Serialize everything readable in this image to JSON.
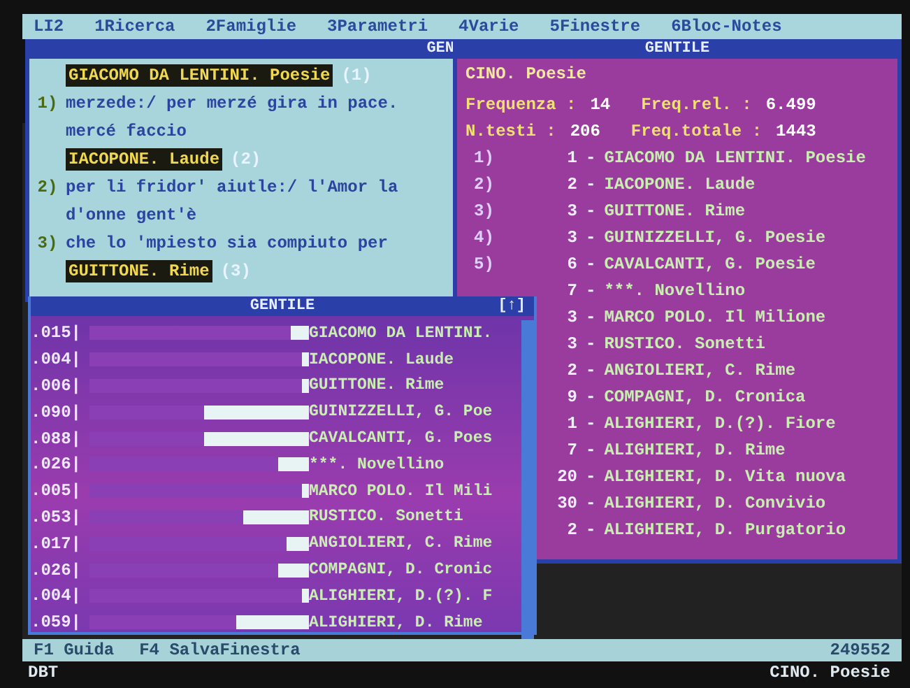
{
  "menu": [
    {
      "label": "LI2"
    },
    {
      "label": "1Ricerca"
    },
    {
      "label": "2Famiglie"
    },
    {
      "label": "3Parametri"
    },
    {
      "label": "4Varie"
    },
    {
      "label": "5Finestre"
    },
    {
      "label": "6Bloc-Notes"
    }
  ],
  "text_window": {
    "title": "GEN",
    "entries": [
      {
        "kind": "heading",
        "text": "GIACOMO DA LENTINI. Poesie",
        "ref": "(1)"
      },
      {
        "kind": "line",
        "number": "1)",
        "text": "merzede:/ per merzé gira in pace."
      },
      {
        "kind": "line",
        "text": "mercé faccio"
      },
      {
        "kind": "heading",
        "text": "IACOPONE. Laude",
        "ref": "(2)"
      },
      {
        "kind": "line",
        "number": "2)",
        "text": "per li fridor' aiutle:/ l'Amor la"
      },
      {
        "kind": "line",
        "text": "d'onne gent'è"
      },
      {
        "kind": "line",
        "number": "3)",
        "text": "che lo 'mpiesto sia compiuto per"
      },
      {
        "kind": "heading",
        "text": "GUITTONE. Rime",
        "ref": "(3)"
      }
    ]
  },
  "stats_window": {
    "title": "GENTILE",
    "heading": "CINO. Poesie",
    "stats": [
      [
        {
          "label": "Frequenza :",
          "value": "14"
        },
        {
          "label": "Freq.rel. :",
          "value": "6.499"
        }
      ],
      [
        {
          "label": "N.testi :",
          "value": "206"
        },
        {
          "label": "Freq.totale :",
          "value": "1443"
        }
      ]
    ],
    "rows": [
      {
        "index": "1)",
        "count": "1",
        "dash": "-",
        "name": "GIACOMO DA LENTINI. Poesie"
      },
      {
        "index": "2)",
        "count": "2",
        "dash": "-",
        "name": "IACOPONE. Laude"
      },
      {
        "index": "3)",
        "count": "3",
        "dash": "-",
        "name": "GUITTONE. Rime"
      },
      {
        "index": "4)",
        "count": "3",
        "dash": "-",
        "name": "GUINIZZELLI, G. Poesie"
      },
      {
        "index": "5)",
        "count": "6",
        "dash": "-",
        "name": "CAVALCANTI, G. Poesie"
      },
      {
        "count": "7",
        "dash": "-",
        "name": "***. Novellino"
      },
      {
        "count": "3",
        "dash": "-",
        "name": "MARCO POLO. Il Milione"
      },
      {
        "count": "3",
        "dash": "-",
        "name": "RUSTICO. Sonetti"
      },
      {
        "count": "2",
        "dash": "-",
        "name": "ANGIOLIERI, C. Rime"
      },
      {
        "count": "9",
        "dash": "-",
        "name": "COMPAGNI, D. Cronica"
      },
      {
        "count": "1",
        "dash": "-",
        "name": "ALIGHIERI, D.(?). Fiore"
      },
      {
        "count": "7",
        "dash": "-",
        "name": "ALIGHIERI, D. Rime"
      },
      {
        "count": "20",
        "dash": "-",
        "name": "ALIGHIERI, D. Vita nuova"
      },
      {
        "count": "30",
        "dash": "-",
        "name": "ALIGHIERI, D. Convivio"
      },
      {
        "count": "2",
        "dash": "-",
        "name": "ALIGHIERI, D. Purgatorio"
      }
    ]
  },
  "bar_window": {
    "title": "GENTILE",
    "corner": "[↑]",
    "rows": [
      {
        "value": ".015|",
        "level": 0.08,
        "name": "GIACOMO DA LENTINI."
      },
      {
        "value": ".004|",
        "level": 0.03,
        "name": "IACOPONE. Laude"
      },
      {
        "value": ".006|",
        "level": 0.03,
        "name": "GUITTONE. Rime"
      },
      {
        "value": ".090|",
        "level": 0.48,
        "name": "GUINIZZELLI, G. Poe"
      },
      {
        "value": ".088|",
        "level": 0.48,
        "name": "CAVALCANTI, G. Poes"
      },
      {
        "value": ".026|",
        "level": 0.14,
        "name": "***. Novellino"
      },
      {
        "value": ".005|",
        "level": 0.03,
        "name": "MARCO POLO. Il Mili"
      },
      {
        "value": ".053|",
        "level": 0.3,
        "name": "RUSTICO. Sonetti"
      },
      {
        "value": ".017|",
        "level": 0.1,
        "name": "ANGIOLIERI, C. Rime"
      },
      {
        "value": ".026|",
        "level": 0.14,
        "name": "COMPAGNI, D. Cronic"
      },
      {
        "value": ".004|",
        "level": 0.03,
        "name": "ALIGHIERI, D.(?). F"
      },
      {
        "value": ".059|",
        "level": 0.33,
        "name": "ALIGHIERI, D. Rime"
      }
    ]
  },
  "status_bar": {
    "keys": [
      {
        "label": "F1 Guida"
      },
      {
        "label": "F4 SalvaFinestra"
      }
    ],
    "number": "249552"
  },
  "footer": {
    "left": "DBT",
    "right": "CINO. Poesie"
  }
}
